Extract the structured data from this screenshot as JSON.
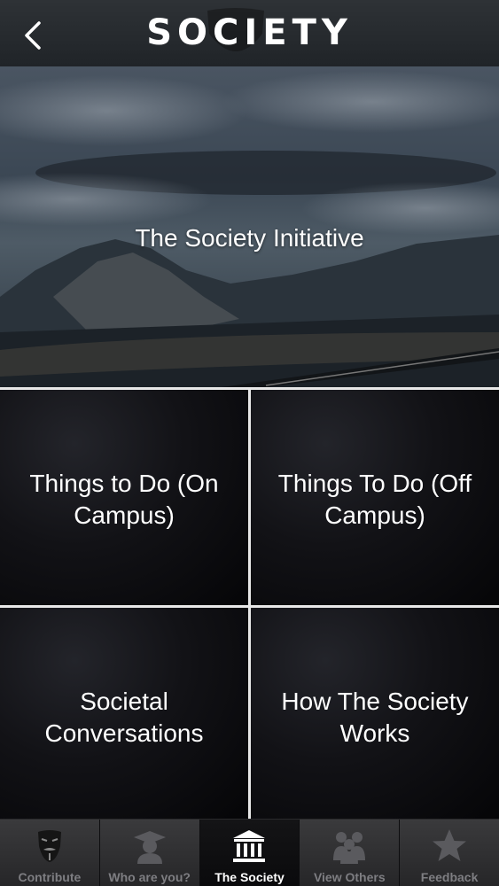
{
  "header": {
    "title": "SOCIETY",
    "back_icon": "chevron-left-icon"
  },
  "hero": {
    "label": "The Society Initiative"
  },
  "tiles": [
    {
      "label": "Things to Do (On Campus)"
    },
    {
      "label": "Things To Do (Off Campus)"
    },
    {
      "label": "Societal Conversations"
    },
    {
      "label": "How The Society Works"
    }
  ],
  "tabbar": {
    "active_index": 2,
    "tabs": [
      {
        "label": "Contribute",
        "icon": "mask-icon"
      },
      {
        "label": "Who are you?",
        "icon": "graduate-icon"
      },
      {
        "label": "The Society",
        "icon": "institution-icon"
      },
      {
        "label": "View Others",
        "icon": "people-icon"
      },
      {
        "label": "Feedback",
        "icon": "star-icon"
      }
    ]
  },
  "colors": {
    "tab_active_text": "#ffffff",
    "tab_inactive_text": "#7e7e82",
    "divider": "#e8e8e8"
  }
}
